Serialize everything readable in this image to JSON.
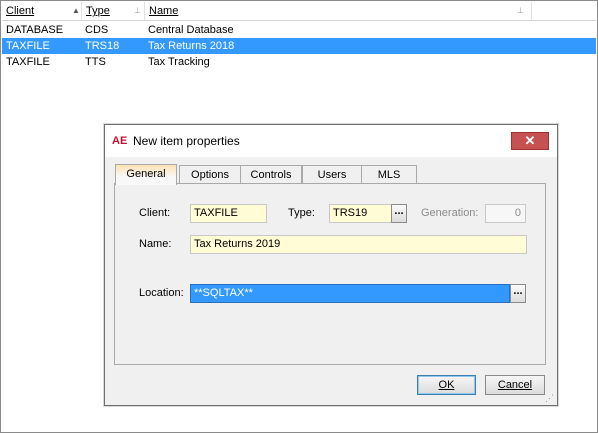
{
  "list": {
    "columns": [
      {
        "label": "Client",
        "sort_glyph": "▲"
      },
      {
        "label": "Type",
        "sort_glyph": "⊥"
      },
      {
        "label": "Name",
        "sort_glyph": "⊥"
      }
    ],
    "rows": [
      {
        "client": "DATABASE",
        "type": "CDS",
        "name": "Central Database",
        "selected": false
      },
      {
        "client": "TAXFILE",
        "type": "TRS18",
        "name": "Tax Returns 2018",
        "selected": true
      },
      {
        "client": "TAXFILE",
        "type": "TTS",
        "name": "Tax Tracking",
        "selected": false
      }
    ]
  },
  "dialog": {
    "app_icon": "AE",
    "title": "New item properties",
    "close_glyph": "✕",
    "tabs": [
      {
        "label": "General",
        "active": true
      },
      {
        "label": "Options",
        "active": false
      },
      {
        "label": "Controls",
        "active": false
      },
      {
        "label": "Users",
        "active": false
      },
      {
        "label": "MLS",
        "active": false
      }
    ],
    "fields": {
      "client_label": "Client:",
      "client_value": "TAXFILE",
      "type_label": "Type:",
      "type_value": "TRS19",
      "type_browse": "...",
      "generation_label": "Generation:",
      "generation_value": "0",
      "name_label": "Name:",
      "name_value": "Tax Returns 2019",
      "location_label": "Location:",
      "location_value": "**SQLTAX**",
      "location_browse": "..."
    },
    "buttons": {
      "ok_label": "OK",
      "cancel_label": "Cancel"
    }
  },
  "colors": {
    "selection": "#3399ff",
    "field_required": "#fffcd6",
    "close_button": "#c75050",
    "active_tab_top": "#fde2b3"
  }
}
